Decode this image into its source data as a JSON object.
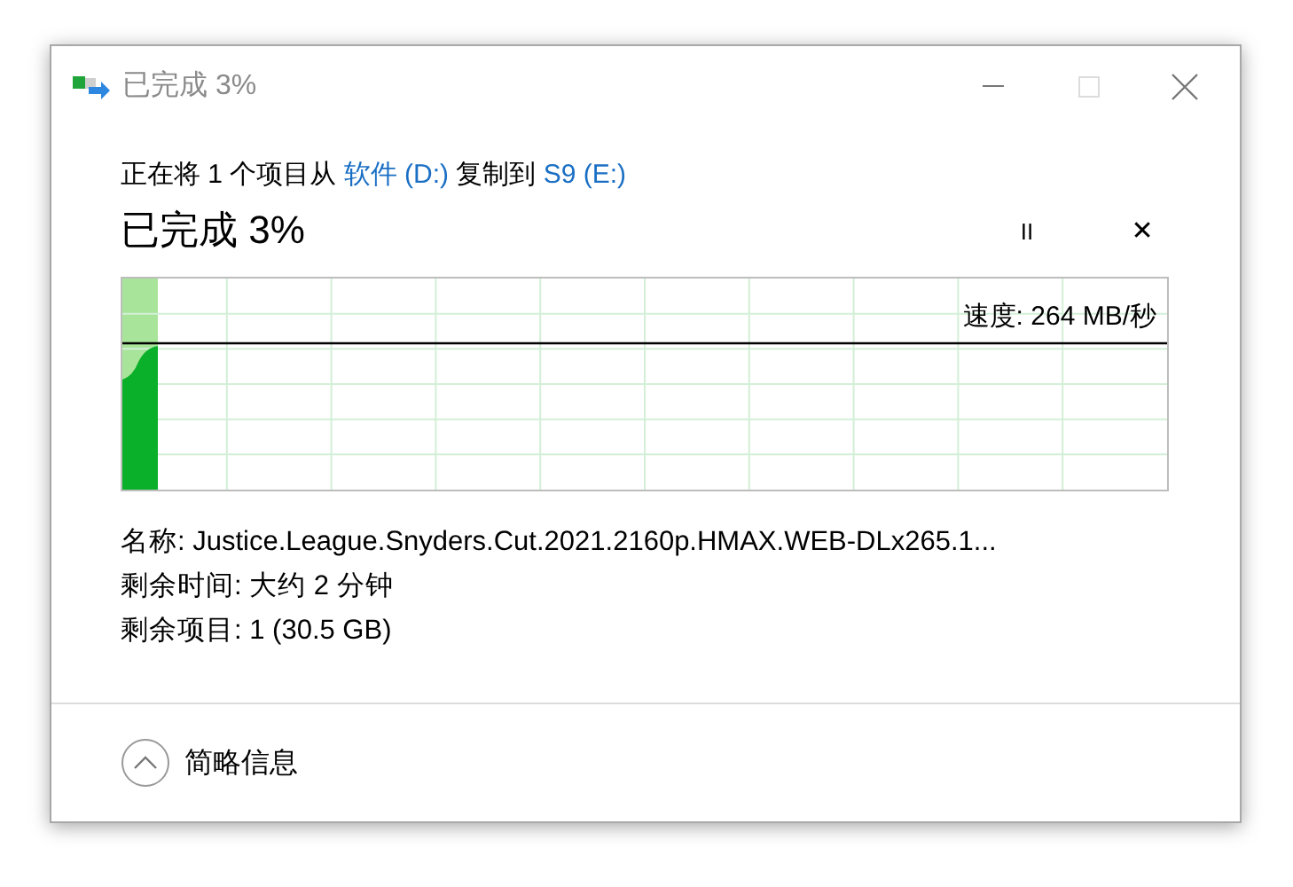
{
  "window": {
    "title": "已完成 3%"
  },
  "source_line": [
    {
      "kind": "text",
      "text": "正在将 1 个项目从 "
    },
    {
      "kind": "link",
      "text": "软件 (D:)"
    },
    {
      "kind": "text",
      "text": " 复制到 "
    },
    {
      "kind": "link",
      "text": "S9 (E:)"
    }
  ],
  "heading": "已完成 3%",
  "controls": {
    "pause": "II",
    "cancel": "✕"
  },
  "graph": {
    "speed": "速度: 264 MB/秒"
  },
  "details": [
    {
      "label": "名称:",
      "value": "Justice.League.Snyders.Cut.2021.2160p.HMAX.WEB-DLx265.1..."
    },
    {
      "label": "剩余时间:",
      "value": "大约 2 分钟"
    },
    {
      "label": "剩余项目:",
      "value": "1 (30.5 GB)"
    }
  ],
  "footer": {
    "button": "简略信息",
    "expanded": true
  }
}
